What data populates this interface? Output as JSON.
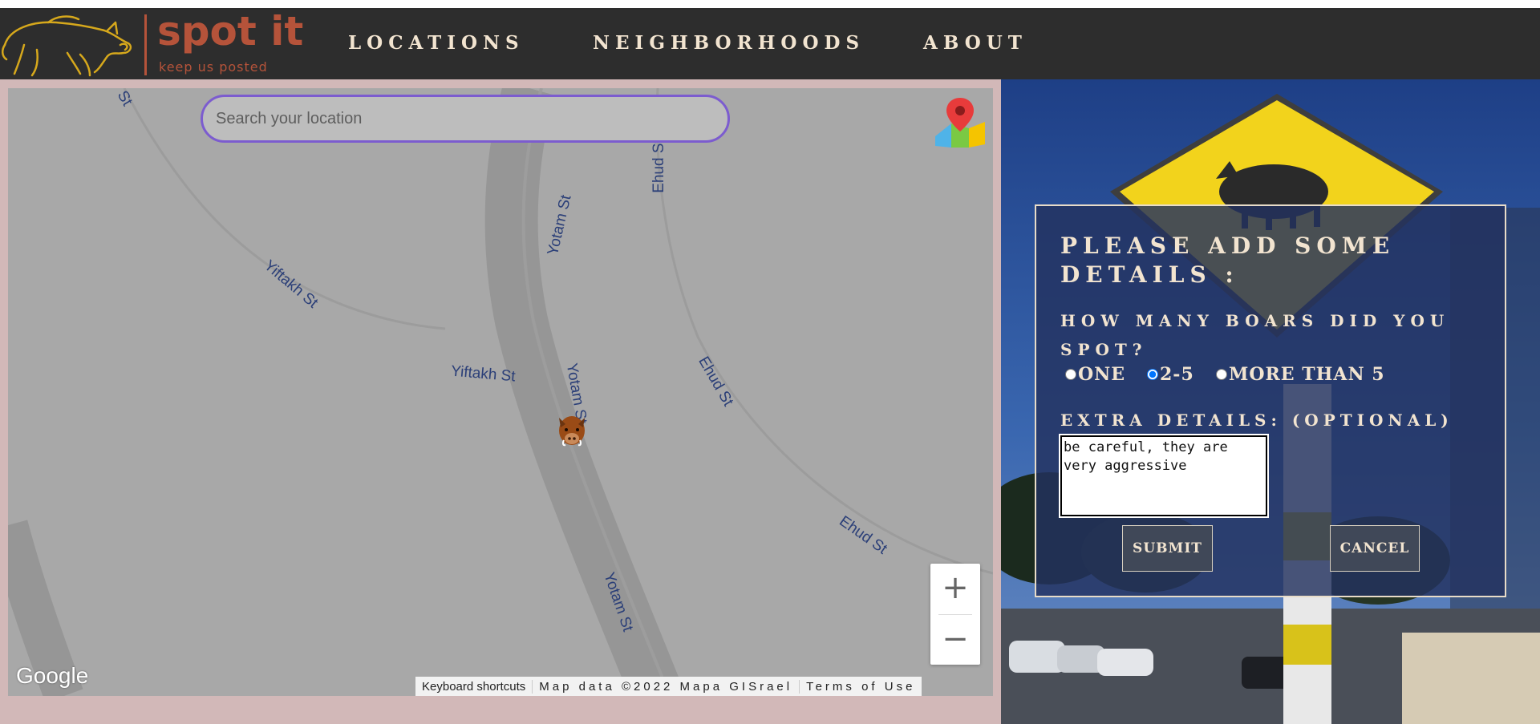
{
  "brand": {
    "name": "spot it",
    "tagline": "keep us posted"
  },
  "nav": {
    "items": [
      {
        "label": "LOCATIONS"
      },
      {
        "label": "NEIGHBORHOODS"
      },
      {
        "label": "ABOUT"
      }
    ]
  },
  "map": {
    "search_placeholder": "Search your location",
    "streets": [
      "Yotam St",
      "Yotam St",
      "Yotam St",
      "Yiftakh St",
      "Yiftakh St",
      "Ehud St",
      "Ehud St",
      "Ehud St",
      "St"
    ],
    "zoom_in": "+",
    "zoom_out": "−",
    "provider_logo": "Google",
    "attribution": {
      "shortcuts": "Keyboard shortcuts",
      "data": "Map data ©2022 Mapa GISrael",
      "terms": "Terms of Use"
    }
  },
  "modal": {
    "title": "Please add some details :",
    "question": "How many boars did you spot?",
    "options": [
      {
        "label": "ONE",
        "value": "one",
        "checked": false
      },
      {
        "label": "2-5",
        "value": "2-5",
        "checked": true
      },
      {
        "label": "MORE THAN 5",
        "value": "more-than-5",
        "checked": false
      }
    ],
    "extra_label": "Extra details: (optional)",
    "details_value": "be careful, they are very aggressive",
    "submit_label": "Submit",
    "cancel_label": "Cancel"
  },
  "colors": {
    "navbar": "#2d2d2d",
    "brand": "#b5533a",
    "nav_text": "#f2e4d0",
    "map_bg": "#a8a8a8",
    "map_frame": "#d2b8b8",
    "search_border": "#7c5ccf",
    "street_label": "#2b3f78",
    "modal_bg": "#23325f"
  },
  "icons": {
    "logo": "boar-logo-icon",
    "maps": "google-maps-pin-icon",
    "marker": "boar-marker-icon",
    "sign": "boar-crossing-sign"
  }
}
